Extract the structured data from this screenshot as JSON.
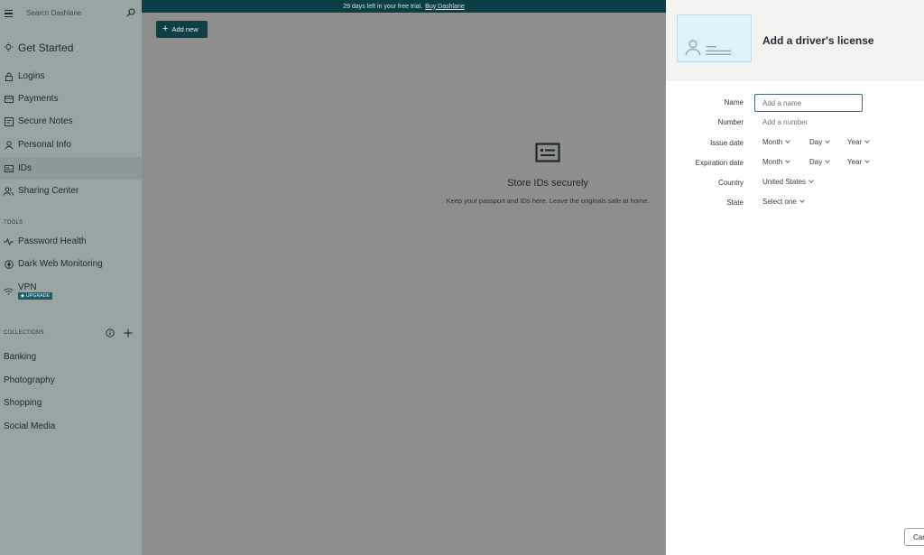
{
  "sidebar": {
    "search_placeholder": "Search Dashlane",
    "get_started": "Get Started",
    "items": [
      {
        "label": "Logins"
      },
      {
        "label": "Payments"
      },
      {
        "label": "Secure Notes"
      },
      {
        "label": "Personal Info"
      },
      {
        "label": "IDs"
      },
      {
        "label": "Sharing Center"
      }
    ],
    "tools_label": "TOOLS",
    "tools": [
      {
        "label": "Password Health"
      },
      {
        "label": "Dark Web Monitoring"
      },
      {
        "label": "VPN"
      }
    ],
    "vpn_badge": "UPGRADE",
    "collections_label": "COLLECTIONS",
    "collections": [
      "Banking",
      "Photography",
      "Shopping",
      "Social Media"
    ]
  },
  "banner": {
    "text": "29 days left in your free trial.",
    "link": "Buy Dashlane"
  },
  "main": {
    "add_new_label": "Add new",
    "empty_title": "Store IDs securely",
    "empty_desc": "Keep your passport and IDs here. Leave the originals safe at home."
  },
  "panel": {
    "title": "Add a driver's license",
    "fields": {
      "name_label": "Name",
      "name_placeholder": "Add a name",
      "number_label": "Number",
      "number_placeholder": "Add a number",
      "issue_label": "Issue date",
      "expiration_label": "Expiration date",
      "month": "Month",
      "day": "Day",
      "year": "Year",
      "country_label": "Country",
      "country_value": "United States",
      "state_label": "State",
      "state_value": "Select one"
    },
    "cancel_label": "Car"
  },
  "colors": {
    "banner_bg": "#0c3e47",
    "accent": "#0f3f47",
    "sidebar_bg": "#96a4a3",
    "thumb_bg": "#ddf3fb"
  }
}
